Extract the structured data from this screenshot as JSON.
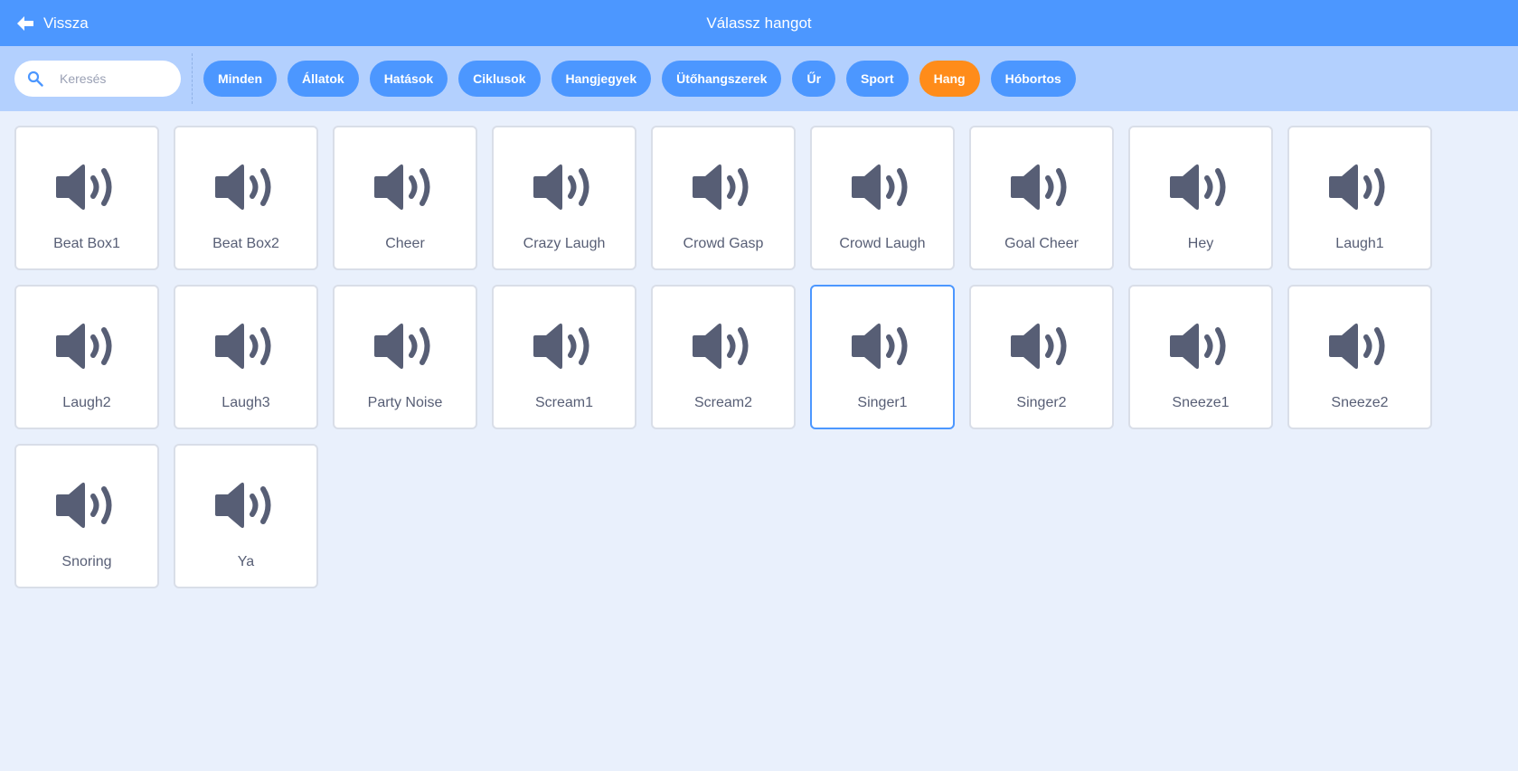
{
  "header": {
    "back_label": "Vissza",
    "title": "Válassz hangot"
  },
  "search": {
    "placeholder": "Keresés",
    "value": ""
  },
  "tags": [
    {
      "label": "Minden",
      "active": false
    },
    {
      "label": "Állatok",
      "active": false
    },
    {
      "label": "Hatások",
      "active": false
    },
    {
      "label": "Ciklusok",
      "active": false
    },
    {
      "label": "Hangjegyek",
      "active": false
    },
    {
      "label": "Ütőhangszerek",
      "active": false
    },
    {
      "label": "Űr",
      "active": false
    },
    {
      "label": "Sport",
      "active": false
    },
    {
      "label": "Hang",
      "active": true
    },
    {
      "label": "Hóbortos",
      "active": false
    }
  ],
  "sounds": [
    {
      "label": "Beat Box1",
      "icon": "speaker-icon",
      "selected": false
    },
    {
      "label": "Beat Box2",
      "icon": "speaker-icon",
      "selected": false
    },
    {
      "label": "Cheer",
      "icon": "speaker-icon",
      "selected": false
    },
    {
      "label": "Crazy Laugh",
      "icon": "speaker-icon",
      "selected": false
    },
    {
      "label": "Crowd Gasp",
      "icon": "speaker-icon",
      "selected": false
    },
    {
      "label": "Crowd Laugh",
      "icon": "speaker-icon",
      "selected": false
    },
    {
      "label": "Goal Cheer",
      "icon": "speaker-icon",
      "selected": false
    },
    {
      "label": "Hey",
      "icon": "speaker-icon",
      "selected": false
    },
    {
      "label": "Laugh1",
      "icon": "speaker-icon",
      "selected": false
    },
    {
      "label": "Laugh2",
      "icon": "speaker-icon",
      "selected": false
    },
    {
      "label": "Laugh3",
      "icon": "speaker-icon",
      "selected": false
    },
    {
      "label": "Party Noise",
      "icon": "speaker-icon",
      "selected": false
    },
    {
      "label": "Scream1",
      "icon": "speaker-icon",
      "selected": false
    },
    {
      "label": "Scream2",
      "icon": "speaker-icon",
      "selected": false
    },
    {
      "label": "Singer1",
      "icon": "speaker-icon",
      "selected": true
    },
    {
      "label": "Singer2",
      "icon": "speaker-icon",
      "selected": false
    },
    {
      "label": "Sneeze1",
      "icon": "speaker-icon",
      "selected": false
    },
    {
      "label": "Sneeze2",
      "icon": "speaker-icon",
      "selected": false
    },
    {
      "label": "Snoring",
      "icon": "speaker-icon",
      "selected": false
    },
    {
      "label": "Ya",
      "icon": "speaker-icon",
      "selected": false
    }
  ],
  "colors": {
    "header_bg": "#4c97ff",
    "filter_bg": "#b3d0fe",
    "page_bg": "#e9f0fc",
    "active_tag": "#ff8c1a",
    "icon": "#575e75"
  }
}
